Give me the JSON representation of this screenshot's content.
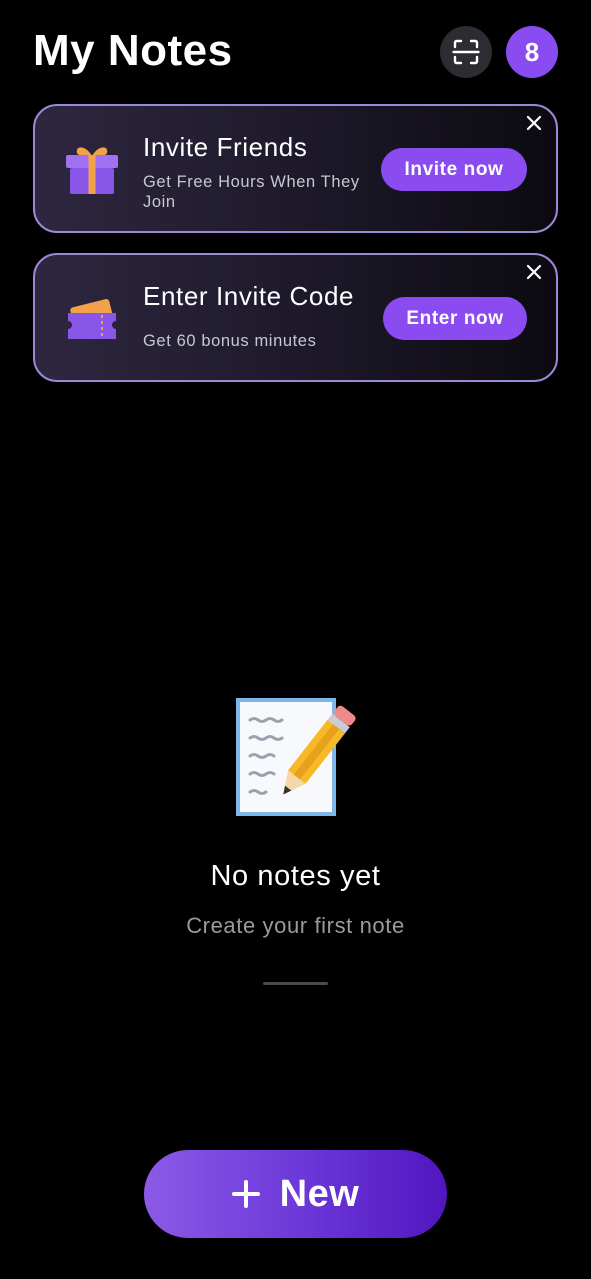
{
  "header": {
    "title": "My Notes",
    "scan_icon": "scan-icon",
    "badge_count": "8"
  },
  "cards": [
    {
      "icon": "gift-icon",
      "title": "Invite Friends",
      "subtitle": "Get Free Hours When They Join",
      "button_label": "Invite now",
      "close_icon": "close-icon"
    },
    {
      "icon": "ticket-icon",
      "title": "Enter Invite Code",
      "subtitle": "Get 60 bonus minutes",
      "button_label": "Enter now",
      "close_icon": "close-icon"
    }
  ],
  "empty_state": {
    "icon": "memo-pencil-icon",
    "title": "No notes yet",
    "subtitle": "Create your first note"
  },
  "new_button": {
    "icon": "plus-icon",
    "label": "New"
  },
  "colors": {
    "background": "#000000",
    "accent": "#8a4cf0",
    "card_border": "#9c88d6",
    "muted_text": "#9a9aa0"
  }
}
